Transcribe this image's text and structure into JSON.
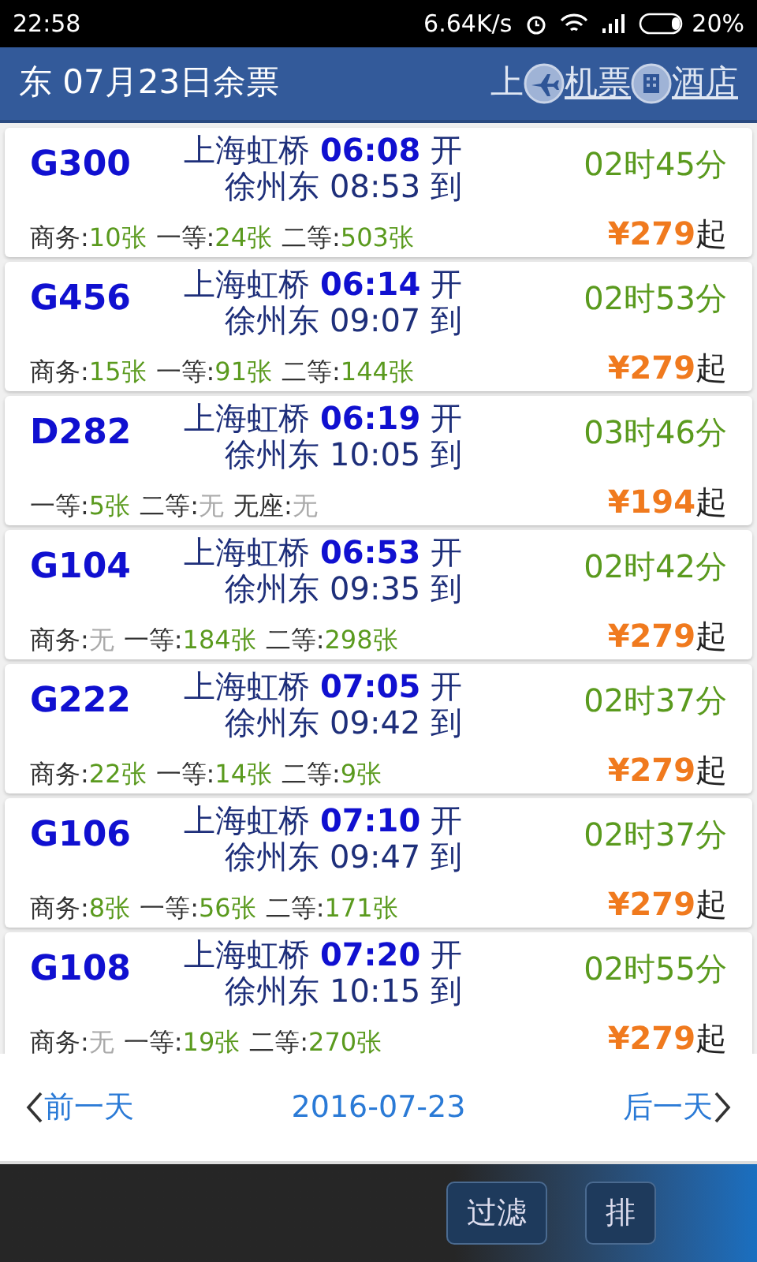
{
  "status_bar": {
    "time": "22:58",
    "speed": "6.64K/s",
    "battery": "20%"
  },
  "header": {
    "title": "东 07月23日余票",
    "marquee_tail": "上",
    "links": [
      {
        "kind": "plane",
        "label": "机票"
      },
      {
        "kind": "hotel",
        "label": "酒店"
      }
    ]
  },
  "trains": [
    {
      "code": "G300",
      "from": "上海虹桥",
      "depart": "06:08",
      "depart_mark": "开",
      "to": "徐州东",
      "arrive": "08:53",
      "arrive_mark": "到",
      "duration": "02时45分",
      "price_symbol": "¥",
      "price": "279",
      "price_suffix": "起",
      "seats": [
        {
          "label": "商务:",
          "value": "10张",
          "available": true
        },
        {
          "label": "一等:",
          "value": "24张",
          "available": true
        },
        {
          "label": "二等:",
          "value": "503张",
          "available": true
        }
      ]
    },
    {
      "code": "G456",
      "from": "上海虹桥",
      "depart": "06:14",
      "depart_mark": "开",
      "to": "徐州东",
      "arrive": "09:07",
      "arrive_mark": "到",
      "duration": "02时53分",
      "price_symbol": "¥",
      "price": "279",
      "price_suffix": "起",
      "seats": [
        {
          "label": "商务:",
          "value": "15张",
          "available": true
        },
        {
          "label": "一等:",
          "value": "91张",
          "available": true
        },
        {
          "label": "二等:",
          "value": "144张",
          "available": true
        }
      ]
    },
    {
      "code": "D282",
      "from": "上海虹桥",
      "depart": "06:19",
      "depart_mark": "开",
      "to": "徐州东",
      "arrive": "10:05",
      "arrive_mark": "到",
      "duration": "03时46分",
      "price_symbol": "¥",
      "price": "194",
      "price_suffix": "起",
      "seats": [
        {
          "label": "一等:",
          "value": "5张",
          "available": true
        },
        {
          "label": "二等:",
          "value": "无",
          "available": false
        },
        {
          "label": "无座:",
          "value": "无",
          "available": false
        }
      ]
    },
    {
      "code": "G104",
      "from": "上海虹桥",
      "depart": "06:53",
      "depart_mark": "开",
      "to": "徐州东",
      "arrive": "09:35",
      "arrive_mark": "到",
      "duration": "02时42分",
      "price_symbol": "¥",
      "price": "279",
      "price_suffix": "起",
      "seats": [
        {
          "label": "商务:",
          "value": "无",
          "available": false
        },
        {
          "label": "一等:",
          "value": "184张",
          "available": true
        },
        {
          "label": "二等:",
          "value": "298张",
          "available": true
        }
      ]
    },
    {
      "code": "G222",
      "from": "上海虹桥",
      "depart": "07:05",
      "depart_mark": "开",
      "to": "徐州东",
      "arrive": "09:42",
      "arrive_mark": "到",
      "duration": "02时37分",
      "price_symbol": "¥",
      "price": "279",
      "price_suffix": "起",
      "seats": [
        {
          "label": "商务:",
          "value": "22张",
          "available": true
        },
        {
          "label": "一等:",
          "value": "14张",
          "available": true
        },
        {
          "label": "二等:",
          "value": "9张",
          "available": true
        }
      ]
    },
    {
      "code": "G106",
      "from": "上海虹桥",
      "depart": "07:10",
      "depart_mark": "开",
      "to": "徐州东",
      "arrive": "09:47",
      "arrive_mark": "到",
      "duration": "02时37分",
      "price_symbol": "¥",
      "price": "279",
      "price_suffix": "起",
      "seats": [
        {
          "label": "商务:",
          "value": "8张",
          "available": true
        },
        {
          "label": "一等:",
          "value": "56张",
          "available": true
        },
        {
          "label": "二等:",
          "value": "171张",
          "available": true
        }
      ]
    },
    {
      "code": "G108",
      "from": "上海虹桥",
      "depart": "07:20",
      "depart_mark": "开",
      "to": "徐州东",
      "arrive": "10:15",
      "arrive_mark": "到",
      "duration": "02时55分",
      "price_symbol": "¥",
      "price": "279",
      "price_suffix": "起",
      "seats": [
        {
          "label": "商务:",
          "value": "无",
          "available": false
        },
        {
          "label": "一等:",
          "value": "19张",
          "available": true
        },
        {
          "label": "二等:",
          "value": "270张",
          "available": true
        }
      ]
    }
  ],
  "date_nav": {
    "prev": "前一天",
    "date": "2016-07-23",
    "next": "后一天"
  },
  "toolbar": {
    "buttons": [
      "过滤",
      "排"
    ]
  }
}
